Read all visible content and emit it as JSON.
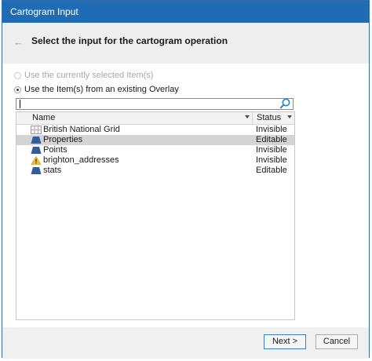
{
  "window": {
    "title": "Cartogram Input"
  },
  "header": {
    "back_icon": "back-arrow-icon",
    "heading": "Select the input for the cartogram operation"
  },
  "options": {
    "selected_items": {
      "label": "Use the currently selected Item(s)",
      "checked": false,
      "enabled": false
    },
    "existing_overlay": {
      "label": "Use the Item(s) from an existing Overlay",
      "checked": true,
      "enabled": true
    }
  },
  "search": {
    "value": "",
    "placeholder": ""
  },
  "grid": {
    "columns": {
      "name": "Name",
      "status": "Status"
    },
    "rows": [
      {
        "name": "British National Grid",
        "status": "Invisible",
        "icon": "grid-layer-icon",
        "selected": false
      },
      {
        "name": "Properties",
        "status": "Editable",
        "icon": "polygon-layer-icon",
        "selected": true
      },
      {
        "name": "Points",
        "status": "Invisible",
        "icon": "polygon-layer-icon",
        "selected": false
      },
      {
        "name": "brighton_addresses",
        "status": "Invisible",
        "icon": "warning-icon",
        "selected": false
      },
      {
        "name": "stats",
        "status": "Editable",
        "icon": "polygon-layer-icon",
        "selected": false
      }
    ]
  },
  "buttons": {
    "next": "Next >",
    "cancel": "Cancel"
  },
  "colors": {
    "titlebar": "#1f6cb4",
    "selection": "#d4d4d4",
    "layer_icon": "#2e5e9e",
    "warning": "#f0c020"
  }
}
